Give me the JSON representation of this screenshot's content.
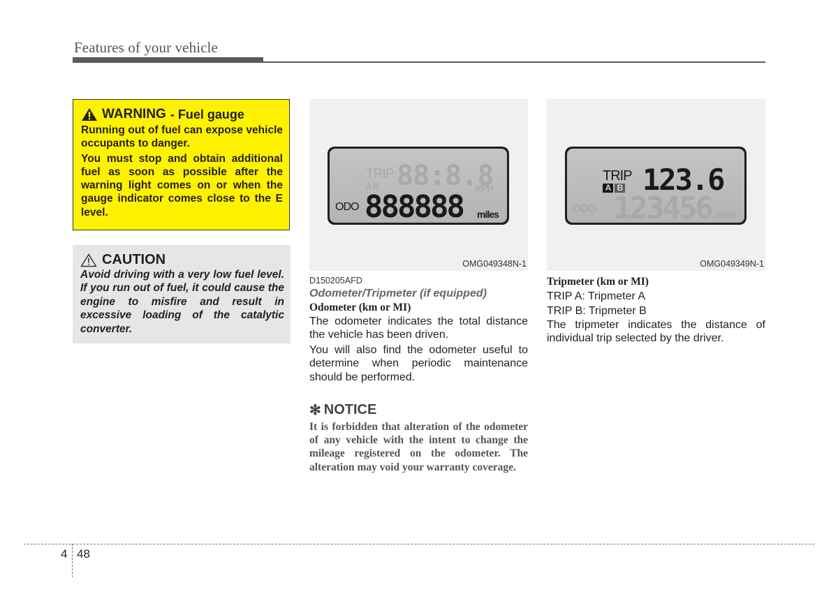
{
  "header": {
    "title": "Features of your vehicle"
  },
  "warning": {
    "icon": "warning-triangle-filled-icon",
    "label": "WARNING",
    "subtitle": "- Fuel gauge",
    "paragraphs": [
      "Running out of fuel can expose vehicle occupants to danger.",
      "You must stop and obtain additional fuel as soon as possible after the warning light comes on or when the gauge indicator comes close to the E level."
    ],
    "background_color": "#fff200"
  },
  "caution": {
    "icon": "warning-triangle-outline-icon",
    "label": "CAUTION",
    "text": "Avoid driving with a very low fuel level. If you run out of fuel, it could cause the engine to misfire and result in excessive loading of the catalytic converter.",
    "background_color": "#e6e6e6"
  },
  "figures": [
    {
      "code": "OMG049348N-1",
      "lcd": {
        "trip_label": "TRIP",
        "trip_ab": "AB",
        "trip_digits": "88:8.8",
        "speed_unit": "MPH",
        "odo_label": "ODO",
        "odo_digits": "888888",
        "odo_unit": "miles"
      }
    },
    {
      "code": "OMG049349N-1",
      "lcd": {
        "trip_label": "TRIP",
        "trip_a": "A",
        "trip_b": "B",
        "trip_digits": "123.6",
        "odo_label": "ODO",
        "odo_digits": "123456",
        "odo_unit": "miles"
      }
    }
  ],
  "odometer_section": {
    "code": "D150205AFD",
    "title": "Odometer/Tripmeter (if equipped)",
    "heading": "Odometer (km or MI)",
    "paragraphs": [
      "The odometer indicates the total distance the vehicle has been driven.",
      "You will also find the odometer useful to determine when periodic maintenance should be performed."
    ]
  },
  "notice": {
    "icon": "asterisk-icon",
    "symbol": "✻",
    "label": "NOTICE",
    "text": "It is forbidden that alteration of the odometer of any vehicle with the intent to change the mileage registered on the odometer. The alteration may void your warranty coverage."
  },
  "tripmeter_section": {
    "heading": "Tripmeter (km or MI)",
    "lines": [
      "TRIP A: Tripmeter A",
      "TRIP B: Tripmeter B"
    ],
    "paragraph": "The tripmeter indicates the distance of individual trip selected by the driver."
  },
  "footer": {
    "chapter": "4",
    "page": "48"
  }
}
